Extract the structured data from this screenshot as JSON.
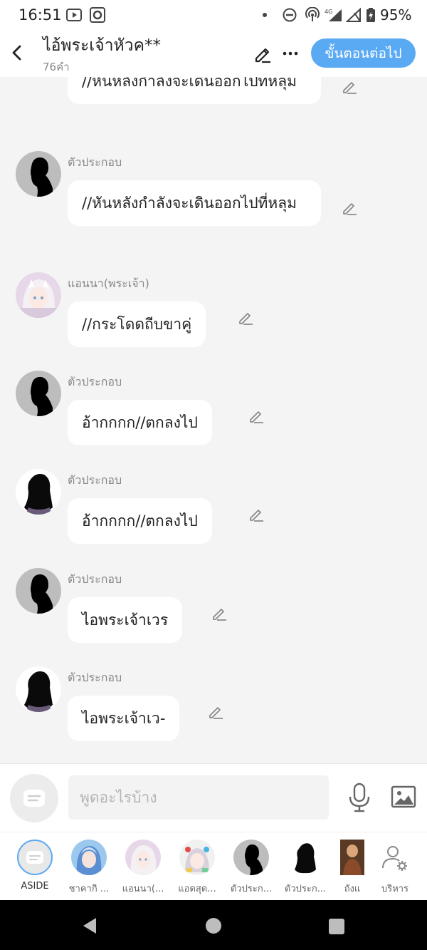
{
  "status_bar": {
    "time": "16:51",
    "battery": "95%"
  },
  "header": {
    "title": "ไอ้พระเจ้าหัวค**",
    "word_count": "76คำ",
    "next_label": "ขั้นตอนต่อไป"
  },
  "messages": [
    {
      "sender": "",
      "text": "//หันหลังกำลังจะเดินออกไปที่หลุม",
      "avatar": "none"
    },
    {
      "sender": "ตัวประกอบ",
      "text": "//หันหลังกำลังจะเดินออกไปที่หลุม",
      "avatar": "silhouette-short"
    },
    {
      "sender": "แอนนา(พระเจ้า)",
      "text": "//กระโดดถีบขาคู่",
      "avatar": "anime-white"
    },
    {
      "sender": "ตัวประกอบ",
      "text": "อ้ากกกก//ตกลงไป",
      "avatar": "silhouette-short"
    },
    {
      "sender": "ตัวประกอบ",
      "text": "อ้ากกกก//ตกลงไป",
      "avatar": "silhouette-long"
    },
    {
      "sender": "ตัวประกอบ",
      "text": "ไอพระเจ้าเวร",
      "avatar": "silhouette-short"
    },
    {
      "sender": "ตัวประกอบ",
      "text": "ไอพระเจ้าเว-",
      "avatar": "silhouette-long"
    }
  ],
  "input": {
    "placeholder": "พูดอะไรบ้าง"
  },
  "characters": [
    {
      "label": "ASIDE",
      "avatar": "aside-icon"
    },
    {
      "label": "ชาคากิ ...",
      "avatar": "anime-blue"
    },
    {
      "label": "แอนนา(...",
      "avatar": "anime-white"
    },
    {
      "label": "แอดสุด...",
      "avatar": "anime-colorful"
    },
    {
      "label": "ตัวประก...",
      "avatar": "silhouette-short"
    },
    {
      "label": "ตัวประก...",
      "avatar": "silhouette-long"
    },
    {
      "label": "ถังแ",
      "avatar": "warrior"
    },
    {
      "label": "บริหาร",
      "avatar": "manage-icon"
    }
  ],
  "colors": {
    "accent": "#5aa9f3",
    "bubble": "#ffffff",
    "background": "#f4f4f4"
  }
}
